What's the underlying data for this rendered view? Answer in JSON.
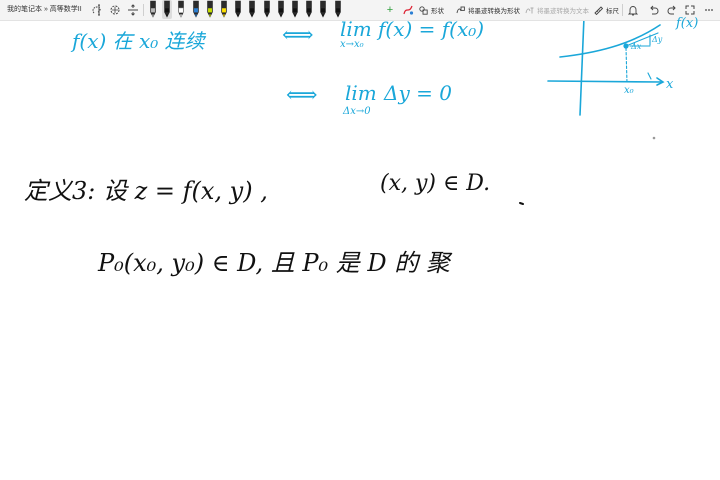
{
  "app": {
    "document_title": "我的笔记本 » 高等数学II"
  },
  "toolbar": {
    "tools": [
      {
        "name": "lasso-select",
        "icon": "lasso-icon"
      },
      {
        "name": "pan",
        "icon": "pan-icon"
      },
      {
        "name": "add-space",
        "icon": "add-space-icon"
      }
    ],
    "pens": [
      {
        "color": "#b9b9b9",
        "kind": "eraser"
      },
      {
        "color": "#111111",
        "kind": "pen",
        "active": true
      },
      {
        "color": "#ffffff",
        "kind": "pen"
      },
      {
        "color": "#2a7fd4",
        "kind": "pen"
      },
      {
        "color": "#c7e000",
        "kind": "pen"
      },
      {
        "color": "#ffe100",
        "kind": "highlighter"
      },
      {
        "color": "#111111",
        "kind": "pen"
      },
      {
        "color": "#111111",
        "kind": "pen"
      },
      {
        "color": "#111111",
        "kind": "pen"
      },
      {
        "color": "#111111",
        "kind": "pen"
      },
      {
        "color": "#111111",
        "kind": "pen"
      },
      {
        "color": "#111111",
        "kind": "pen"
      },
      {
        "color": "#111111",
        "kind": "pen"
      },
      {
        "color": "#111111",
        "kind": "pen"
      }
    ],
    "add_pen": "+",
    "shape_label": "形状",
    "ink_to_shape_label": "将墨迹转换为形状",
    "ink_to_text_label": "将墨迹转换为文本",
    "ruler_label": "标尺"
  },
  "notes": {
    "top_line_left": "f(x) 在 x₀ 连续",
    "iff_1": "⟺",
    "limit_lim": "lim",
    "limit_body": "f(x) = f(x₀)",
    "limit_sub": "x→x₀",
    "iff_2": "⟺",
    "delta_lim": "lim",
    "delta_body": "Δy = 0",
    "delta_sub": "Δx→0",
    "graph_label_fx": "f(x)",
    "graph_label_dy": "Δy",
    "graph_label_dx": "Δx",
    "graph_label_x0": "x₀",
    "graph_label_x": "x",
    "def_line": "定义3: 设 z = f(x, y) ,",
    "def_domain": "(x, y) ∈ D.",
    "point_line": "P₀(x₀, y₀) ∈ D,  且 P₀ 是 D 的 聚"
  },
  "colors": {
    "ink_blue": "#1aa7d9",
    "ink_black": "#111111",
    "toolbar_bg": "#f4f4f4"
  }
}
